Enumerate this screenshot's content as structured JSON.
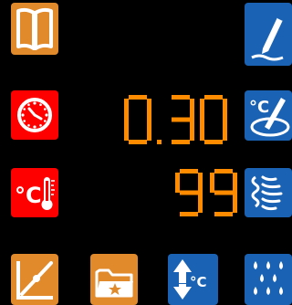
{
  "display": {
    "value_top": "0.30",
    "value_bottom": "99",
    "digit_color": "#ff8c00"
  },
  "tiles": {
    "book": {
      "icon": "book-icon",
      "color": "#e08a2c"
    },
    "clock": {
      "icon": "clock-icon",
      "color": "#ff0000"
    },
    "temp": {
      "icon": "temperature-celsius-icon",
      "label": "°C",
      "color": "#ff0000"
    },
    "slope": {
      "icon": "slope-line-icon",
      "color": "#e08a2c"
    },
    "folder": {
      "icon": "folder-star-icon",
      "color": "#e08a2c"
    },
    "edit": {
      "icon": "pen-edit-icon",
      "color": "#1a63b4"
    },
    "calibrate": {
      "icon": "celsius-calibrate-icon",
      "label": "°C",
      "color": "#1a63b4"
    },
    "wave": {
      "icon": "waves-icon",
      "color": "#1a63b4"
    },
    "updown": {
      "icon": "arrow-updown-celsius-icon",
      "label": "°C",
      "color": "#1a63b4"
    },
    "drops": {
      "icon": "water-drops-icon",
      "color": "#1a63b4"
    }
  }
}
